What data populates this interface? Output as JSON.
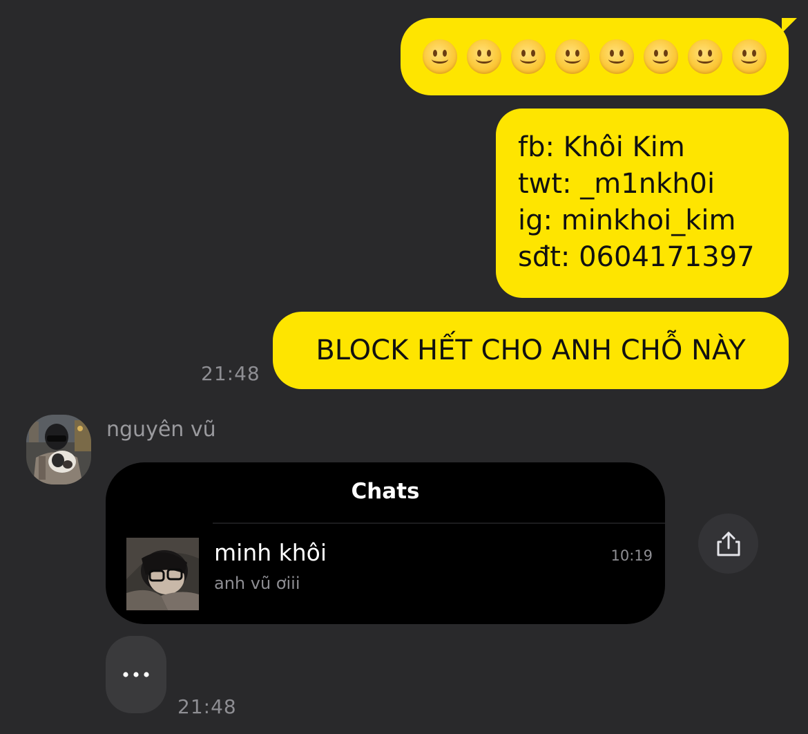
{
  "messages": {
    "emoji_bubble": {
      "emoji": [
        "🙂",
        "🙂",
        "🙂",
        "🙂",
        "🙂",
        "🙂",
        "🙂",
        "🙂"
      ],
      "icon": "slightly-smiling-face-icon"
    },
    "contact_bubble": {
      "lines": [
        "fb: Khôi Kim",
        "twt: _m1nkh0i",
        "ig: minkhoi_kim",
        "sđt: 0604171397"
      ]
    },
    "block_bubble": {
      "text": "BLOCK HẾT CHO ANH CHỖ NÀY"
    },
    "outgoing_time": "21:48"
  },
  "incoming": {
    "sender_name": "nguyên vũ",
    "avatar_icon": "user-avatar",
    "shared_card": {
      "title": "Chats",
      "chat_name": "minh khôi",
      "chat_preview": "anh vũ ơiii",
      "chat_time": "10:19",
      "thumb_icon": "profile-photo"
    },
    "share_icon": "share-icon",
    "typing_text": "...",
    "time": "21:48"
  },
  "colors": {
    "background": "#29292b",
    "outgoing_bubble": "#fee500",
    "card_background": "#000000",
    "muted_text": "#8e8e93"
  }
}
